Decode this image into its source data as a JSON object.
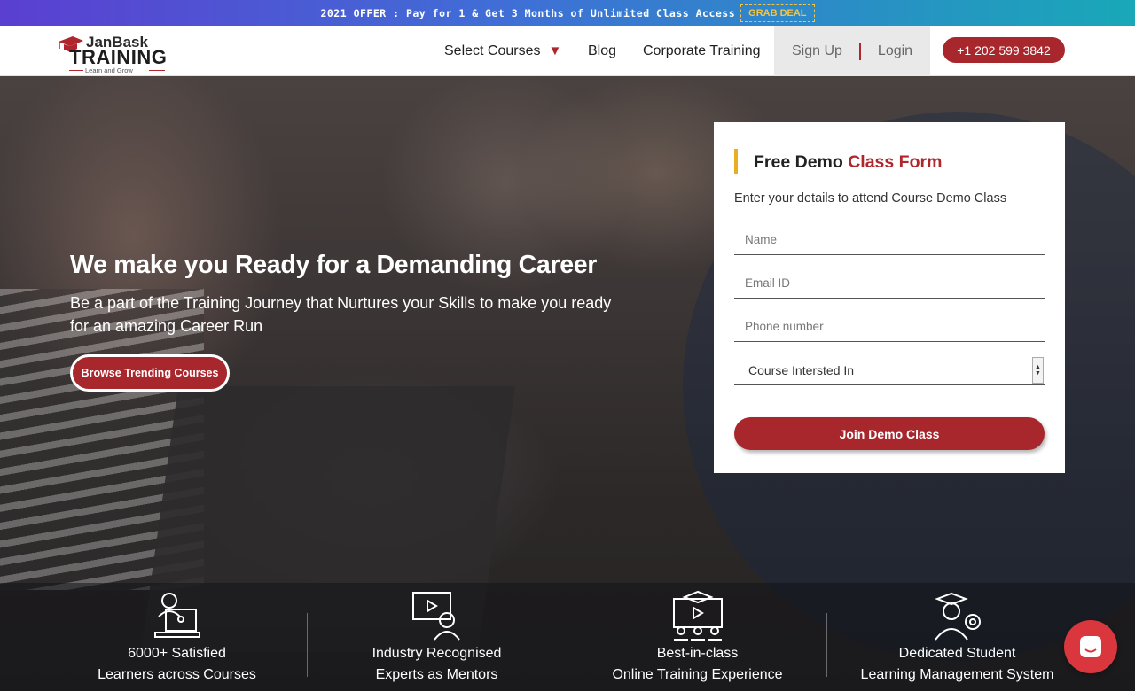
{
  "offer": {
    "text": "2021 OFFER : Pay for 1 & Get 3 Months of Unlimited Class Access",
    "cta": "GRAB DEAL"
  },
  "logo": {
    "brand_top": "JanBask",
    "brand_main": "TRAINING",
    "tagline": "Learn and Grow"
  },
  "nav": {
    "select_courses": "Select Courses",
    "blog": "Blog",
    "corporate": "Corporate Training",
    "signup": "Sign Up",
    "login": "Login",
    "phone": "+1 202 599 3842"
  },
  "hero": {
    "title": "We make you Ready for a Demanding Career",
    "subtitle": "Be a part of the Training Journey that Nurtures your Skills to make you ready for an amazing Career Run",
    "cta": "Browse Trending Courses"
  },
  "form": {
    "title_part1": "Free Demo ",
    "title_part2": "Class Form",
    "description": "Enter your details to attend Course Demo Class",
    "name_placeholder": "Name",
    "email_placeholder": "Email ID",
    "phone_placeholder": "Phone number",
    "course_select": "Course Intersted In",
    "submit": "Join Demo Class"
  },
  "features": [
    {
      "line1": "6000+ Satisfied",
      "line2": "Learners across Courses",
      "icon": "learner-laptop-icon"
    },
    {
      "line1": "Industry Recognised",
      "line2": "Experts as Mentors",
      "icon": "mentor-video-icon"
    },
    {
      "line1": "Best-in-class",
      "line2": "Online Training Experience",
      "icon": "classroom-icon"
    },
    {
      "line1": "Dedicated Student",
      "line2": "Learning Management System",
      "icon": "graduate-icon"
    }
  ],
  "colors": {
    "brand_red": "#a8272d",
    "accent_yellow": "#e8b020",
    "offer_gradient_start": "#5b3fd1",
    "offer_gradient_end": "#19a8b8"
  }
}
